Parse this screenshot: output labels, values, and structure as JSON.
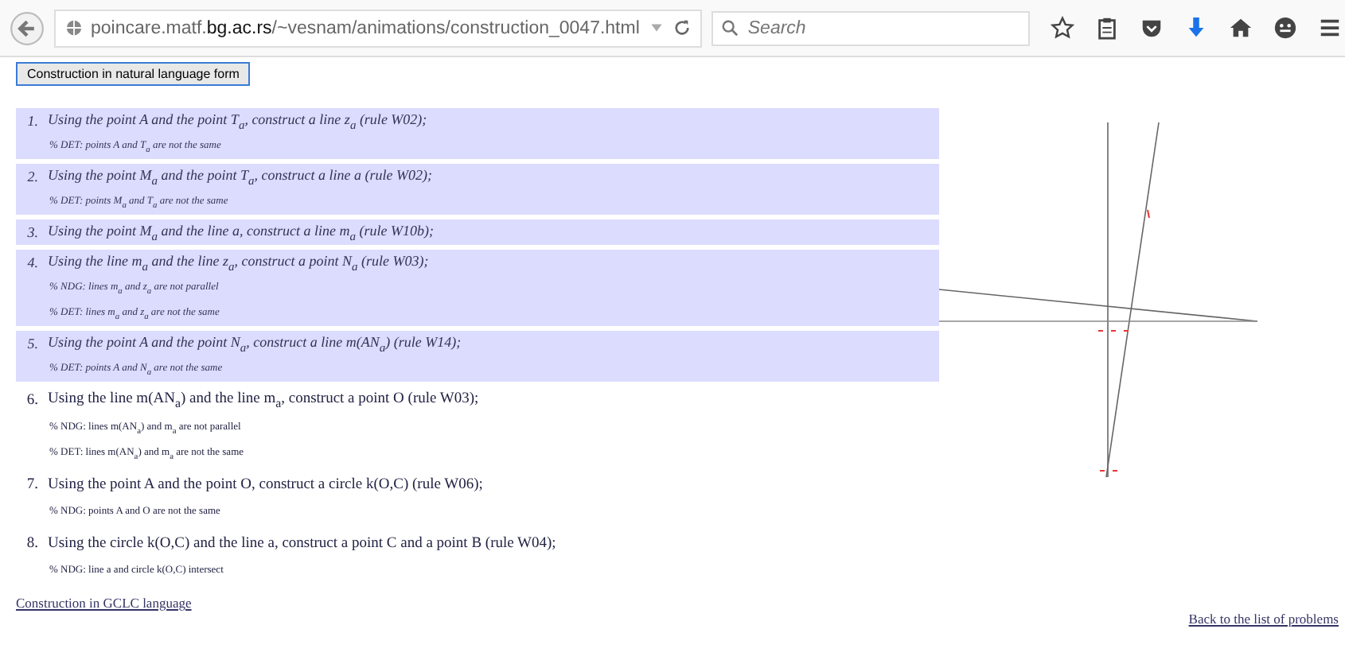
{
  "browser": {
    "url_host": "poincare.matf.",
    "url_domain": "bg.ac.rs",
    "url_path": "/~vesnam/animations/construction_0047.html",
    "search": {
      "placeholder": "Search"
    }
  },
  "toggle_button": "Construction in natural language form",
  "steps": [
    {
      "number": "1.",
      "highlighted": true,
      "text": "Using the point A and the point T$_{a}$, construct a line z$_{a}$ (rule W02);",
      "notes": [
        "% DET: points A and T$_{a}$ are not the same"
      ]
    },
    {
      "number": "2.",
      "highlighted": true,
      "text": "Using the point M$_{a}$ and the point T$_{a}$, construct a line a (rule W02);",
      "notes": [
        "% DET: points M$_{a}$ and T$_{a}$ are not the same"
      ]
    },
    {
      "number": "3.",
      "highlighted": true,
      "text": "Using the point M$_{a}$ and the line a, construct a line m$_{a}$ (rule W10b);"
    },
    {
      "number": "4.",
      "highlighted": true,
      "text": "Using the line m$_{a}$ and the line z$_{a}$, construct a point N$_{a}$ (rule W03);",
      "notes": [
        "% NDG: lines m$_{a}$ and z$_{a}$ are not parallel",
        "% DET: lines m$_{a}$ and z$_{a}$ are not the same"
      ]
    },
    {
      "number": "5.",
      "highlighted": true,
      "text": "Using the point A and the point N$_{a}$, construct a line m(AN$_{a}$) (rule W14);",
      "notes": [
        "% DET: points A and N$_{a}$ are not the same"
      ]
    },
    {
      "number": "6.",
      "highlighted": false,
      "text": "Using the line m(AN$_{a}$) and the line m$_{a}$, construct a point O (rule W03);",
      "notes": [
        "% NDG: lines m(AN$_{a}$) and m$_{a}$ are not parallel",
        "% DET: lines m(AN$_{a}$) and m$_{a}$ are not the same"
      ]
    },
    {
      "number": "7.",
      "highlighted": false,
      "text": "Using the point A and the point O, construct a circle k(O,C) (rule W06);",
      "notes": [
        "% NDG: points A and O are not the same"
      ]
    },
    {
      "number": "8.",
      "highlighted": false,
      "text": "Using the circle k(O,C) and the line a, construct a point C and a point B (rule W04);",
      "notes": [
        "% NDG: line a and circle k(O,C) intersect"
      ]
    }
  ],
  "gclc_link": "Construction in GCLC language",
  "back_link": "Back to the list of problems"
}
